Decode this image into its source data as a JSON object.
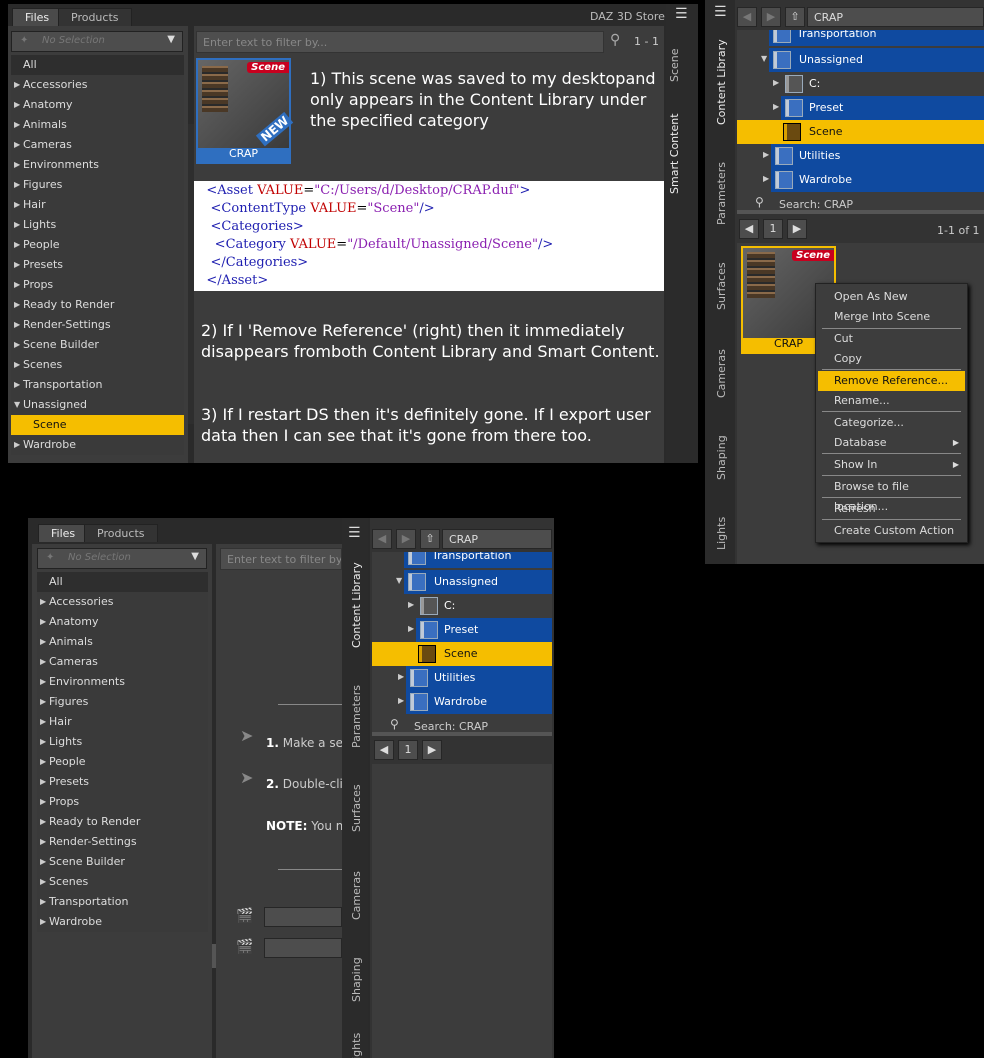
{
  "panel1": {
    "tabs": [
      "Files",
      "Products"
    ],
    "store_label": "DAZ 3D Store",
    "dropdown": "No Selection",
    "filter_placeholder": "Enter text to filter by...",
    "page_range": "1 - 1",
    "categories": [
      "All",
      "Accessories",
      "Anatomy",
      "Animals",
      "Cameras",
      "Environments",
      "Figures",
      "Hair",
      "Lights",
      "People",
      "Presets",
      "Props",
      "Ready to Render",
      "Render-Settings",
      "Scene Builder",
      "Scenes",
      "Transportation",
      "Unassigned",
      "Scene",
      "Wardrobe"
    ],
    "thumb_label": "CRAP",
    "thumb_badge": "Scene",
    "thumb_new": "NEW",
    "note1": "1) This scene was saved to my desktopand only appears in the Content Library under the specified category",
    "code": {
      "l1_tag": "<Asset ",
      "l1_attr": "VALUE",
      "l1_eq": "=",
      "l1_val": "\"C:/Users/d/Desktop/CRAP.duf\"",
      "l1_end": ">",
      "l2_tag": "<ContentType ",
      "l2_attr": "VALUE",
      "l2_eq": "=",
      "l2_val": "\"Scene\"",
      "l2_end": "/>",
      "l3": "<Categories>",
      "l4_tag": "<Category ",
      "l4_attr": "VALUE",
      "l4_eq": "=",
      "l4_val": "\"/Default/Unassigned/Scene\"",
      "l4_end": "/>",
      "l5": "</Categories>",
      "l6": "</Asset>"
    },
    "note2": "2) If I 'Remove Reference' (right) then it immediately disappears fromboth Content Library and Smart Content.",
    "note3": "3) If I restart DS then it's definitely gone. If I export user data then I can see that it's gone from there too.",
    "side_tabs": [
      "Scene",
      "Smart Content"
    ]
  },
  "panel2": {
    "path": "CRAP",
    "side_tabs": [
      "Content Library",
      "Parameters",
      "Surfaces",
      "Cameras",
      "Shaping",
      "Lights"
    ],
    "tree": [
      "Transportation",
      "Unassigned",
      "C:",
      "Preset",
      "Scene",
      "Utilities",
      "Wardrobe"
    ],
    "search": "Search: CRAP",
    "page": "1",
    "page_range": "1-1 of 1",
    "thumb_label": "CRAP",
    "thumb_badge": "Scene",
    "menu": [
      "Open As New",
      "Merge Into Scene",
      "Cut",
      "Copy",
      "Remove Reference...",
      "Rename...",
      "Categorize...",
      "Database",
      "Show In",
      "Browse to file location...",
      "Refresh",
      "Create Custom Action"
    ]
  },
  "panel3": {
    "tabs": [
      "Files",
      "Products"
    ],
    "dropdown": "No Selection",
    "filter_placeholder": "Enter text to filter by...",
    "categories": [
      "All",
      "Accessories",
      "Anatomy",
      "Animals",
      "Cameras",
      "Environments",
      "Figures",
      "Hair",
      "Lights",
      "People",
      "Presets",
      "Props",
      "Ready to Render",
      "Render-Settings",
      "Scene Builder",
      "Scenes",
      "Transportation",
      "Wardrobe"
    ],
    "hint1_num": "1.",
    "hint1": "Make a sel",
    "hint2_num": "2.",
    "hint2": "Double-clic",
    "hint3_label": "NOTE:",
    "hint3": "You ma",
    "side_tabs": [
      "Content Library",
      "Parameters",
      "Surfaces",
      "Cameras",
      "Shaping",
      "Lights"
    ],
    "path": "CRAP",
    "tree": [
      "Transportation",
      "Unassigned",
      "C:",
      "Preset",
      "Scene",
      "Utilities",
      "Wardrobe"
    ],
    "search": "Search: CRAP",
    "page": "1"
  },
  "colors": {
    "selection": "#f5be00",
    "folder_blue": "#0f4aa0",
    "badge_red": "#c8001e"
  }
}
